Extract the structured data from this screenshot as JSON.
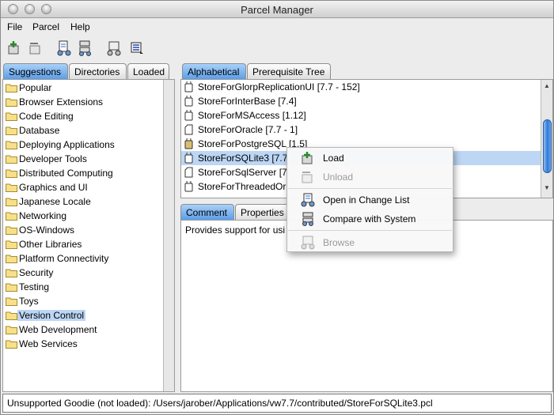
{
  "window": {
    "title": "Parcel Manager"
  },
  "menu": [
    "File",
    "Parcel",
    "Help"
  ],
  "toolbar_icons": [
    "load-parcel-icon",
    "unload-parcel-icon",
    "open-change-list-icon",
    "compare-system-icon",
    "browse-icon",
    "publish-icon"
  ],
  "left_tabs": [
    {
      "label": "Suggestions",
      "active": true
    },
    {
      "label": "Directories",
      "active": false
    },
    {
      "label": "Loaded",
      "active": false
    }
  ],
  "categories": [
    "Popular",
    "Browser Extensions",
    "Code Editing",
    "Database",
    "Deploying Applications",
    "Developer Tools",
    "Distributed Computing",
    "Graphics and UI",
    "Japanese Locale",
    "Networking",
    "OS-Windows",
    "Other Libraries",
    "Platform Connectivity",
    "Security",
    "Testing",
    "Toys",
    "Version Control",
    "Web Development",
    "Web Services"
  ],
  "selected_category": "Version Control",
  "right_tabs": [
    {
      "label": "Alphabetical",
      "active": true
    },
    {
      "label": "Prerequisite Tree",
      "active": false
    }
  ],
  "parcels": [
    {
      "label": "StoreForGlorpReplicationUI [7.7 - 152]",
      "icon": "parcel-icon"
    },
    {
      "label": "StoreForInterBase [7.4]",
      "icon": "parcel-icon"
    },
    {
      "label": "StoreForMSAccess [1.12]",
      "icon": "parcel-icon"
    },
    {
      "label": "StoreForOracle [7.7 - 1]",
      "icon": "parcel-open-icon"
    },
    {
      "label": "StoreForPostgreSQL [1.5]",
      "icon": "parcel-locked-icon"
    },
    {
      "label": "StoreForSQLite3 [7.7",
      "icon": "parcel-icon",
      "selected": true
    },
    {
      "label": "StoreForSqlServer [7.",
      "icon": "parcel-open-icon"
    },
    {
      "label": "StoreForThreadedOr",
      "icon": "parcel-icon"
    }
  ],
  "detail_tabs": [
    {
      "label": "Comment",
      "active": true
    },
    {
      "label": "Properties",
      "active": false
    }
  ],
  "comment_text": "Provides support for usi",
  "context_menu": {
    "items": [
      {
        "label": "Load",
        "enabled": true,
        "icon": "load-icon"
      },
      {
        "label": "Unload",
        "enabled": false,
        "icon": "unload-icon"
      },
      {
        "label": "Open in Change List",
        "enabled": true,
        "icon": "change-list-icon"
      },
      {
        "label": "Compare with System",
        "enabled": true,
        "icon": "compare-icon"
      },
      {
        "label": "Browse",
        "enabled": false,
        "icon": "browse-icon"
      }
    ]
  },
  "status": "Unsupported Goodie (not loaded): /Users/jarober/Applications/vw7.7/contributed/StoreForSQLite3.pcl",
  "colors": {
    "accent": "#5c9ee8",
    "selection": "#bcd6f4"
  }
}
